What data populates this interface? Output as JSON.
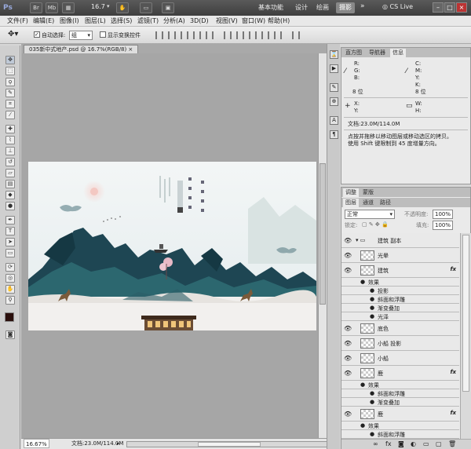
{
  "titlebar": {
    "logo": "Ps",
    "br": "Br",
    "mb": "Mb",
    "zoom": "16.7",
    "workspaces": [
      "基本功能",
      "设计",
      "绘画",
      "摄影"
    ],
    "cslive": "CS Live"
  },
  "menu": [
    "文件(F)",
    "编辑(E)",
    "图像(I)",
    "图层(L)",
    "选择(S)",
    "滤镜(T)",
    "分析(A)",
    "3D(D)",
    "视图(V)",
    "窗口(W)",
    "帮助(H)"
  ],
  "options": {
    "auto_select_label": "自动选择:",
    "auto_select_value": "组",
    "show_transform_label": "显示变换控件"
  },
  "document": {
    "tab_title": "035新中式地产.psd @ 16.7%(RGB/8)",
    "zoom_status": "16.67%",
    "doc_status": "文档:23.0M/114.0M"
  },
  "info_panel": {
    "tabs": [
      "直方图",
      "导航器",
      "信息"
    ],
    "rgb": [
      "R:",
      "G:",
      "B:"
    ],
    "cmyk": [
      "C:",
      "M:",
      "Y:",
      "K:"
    ],
    "bit_left": "8 位",
    "bit_right": "8 位",
    "xy": [
      "X:",
      "Y:"
    ],
    "wh": [
      "W:",
      "H:"
    ],
    "doc": "文档:23.0M/114.0M",
    "hint1": "点按并拖移以移动图层或移动选区的拷贝。",
    "hint2": "使用 Shift 键限制到 45 度增量方向。"
  },
  "adjust_tabs": [
    "调整",
    "蒙版"
  ],
  "layers_panel": {
    "tabs": [
      "图层",
      "通道",
      "路径"
    ],
    "blend": "正常",
    "opacity_label": "不透明度:",
    "opacity": "100%",
    "lock_label": "锁定:",
    "fill_label": "填充:",
    "fill": "100%",
    "rows": [
      {
        "name": "建筑 副本",
        "kind": "group"
      },
      {
        "name": "光晕",
        "kind": "layer"
      },
      {
        "name": "建筑",
        "kind": "layer",
        "fx": "fx"
      },
      {
        "name": "效果",
        "kind": "sub"
      },
      {
        "name": "投影",
        "kind": "subsub"
      },
      {
        "name": "斜面和浮雕",
        "kind": "subsub"
      },
      {
        "name": "渐变叠加",
        "kind": "subsub"
      },
      {
        "name": "光泽",
        "kind": "subsub"
      },
      {
        "name": "底色",
        "kind": "layer"
      },
      {
        "name": "小船 投影",
        "kind": "layer"
      },
      {
        "name": "小船",
        "kind": "layer"
      },
      {
        "name": "鹿",
        "kind": "layer",
        "fx": "fx"
      },
      {
        "name": "效果",
        "kind": "sub"
      },
      {
        "name": "斜面和浮雕",
        "kind": "subsub"
      },
      {
        "name": "渐变叠加",
        "kind": "subsub"
      },
      {
        "name": "鹿",
        "kind": "layer",
        "fx": "fx"
      },
      {
        "name": "效果",
        "kind": "sub"
      },
      {
        "name": "斜面和浮雕",
        "kind": "subsub"
      },
      {
        "name": "渐变叠加",
        "kind": "subsub"
      }
    ]
  },
  "colors": {
    "foreground": "#2a0f0c",
    "background": "#ffffff",
    "workspace_active": "#8a8a8a"
  }
}
